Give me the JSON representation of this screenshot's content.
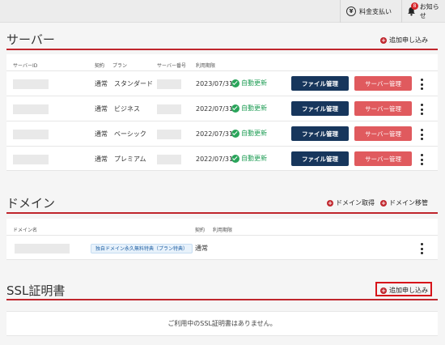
{
  "topbar": {
    "payment_label": "料金支払い",
    "notice_label": "お知らせ",
    "notice_count": "8"
  },
  "servers": {
    "title": "サーバー",
    "add_label": "追加申し込み",
    "columns": {
      "id": "サーバーID",
      "contract": "契約",
      "plan": "プラン",
      "number": "サーバー番号",
      "expiry": "利用期限"
    },
    "rows": [
      {
        "contract": "通常",
        "plan": "スタンダード",
        "expiry": "2023/07/31",
        "renew": "自動更新",
        "file_btn": "ファイル管理",
        "server_btn": "サーバー管理"
      },
      {
        "contract": "通常",
        "plan": "ビジネス",
        "expiry": "2022/07/31",
        "renew": "自動更新",
        "file_btn": "ファイル管理",
        "server_btn": "サーバー管理"
      },
      {
        "contract": "通常",
        "plan": "ベーシック",
        "expiry": "2022/07/31",
        "renew": "自動更新",
        "file_btn": "ファイル管理",
        "server_btn": "サーバー管理"
      },
      {
        "contract": "通常",
        "plan": "プレミアム",
        "expiry": "2022/07/31",
        "renew": "自動更新",
        "file_btn": "ファイル管理",
        "server_btn": "サーバー管理"
      }
    ]
  },
  "domains": {
    "title": "ドメイン",
    "acquire_label": "ドメイン取得",
    "transfer_label": "ドメイン移管",
    "columns": {
      "name": "ドメイン名",
      "contract": "契約",
      "expiry": "利用期限"
    },
    "rows": [
      {
        "tag": "独自ドメイン永久無料特典（プラン特典）",
        "contract": "通常"
      }
    ]
  },
  "ssl": {
    "title": "SSL証明書",
    "add_label": "追加申し込み",
    "empty_message": "ご利用中のSSL証明書はありません。"
  },
  "colors": {
    "accent_red": "#c0262d",
    "file_button": "#17365c",
    "server_button": "#e05a5e",
    "renew_green": "#2aa45a"
  }
}
